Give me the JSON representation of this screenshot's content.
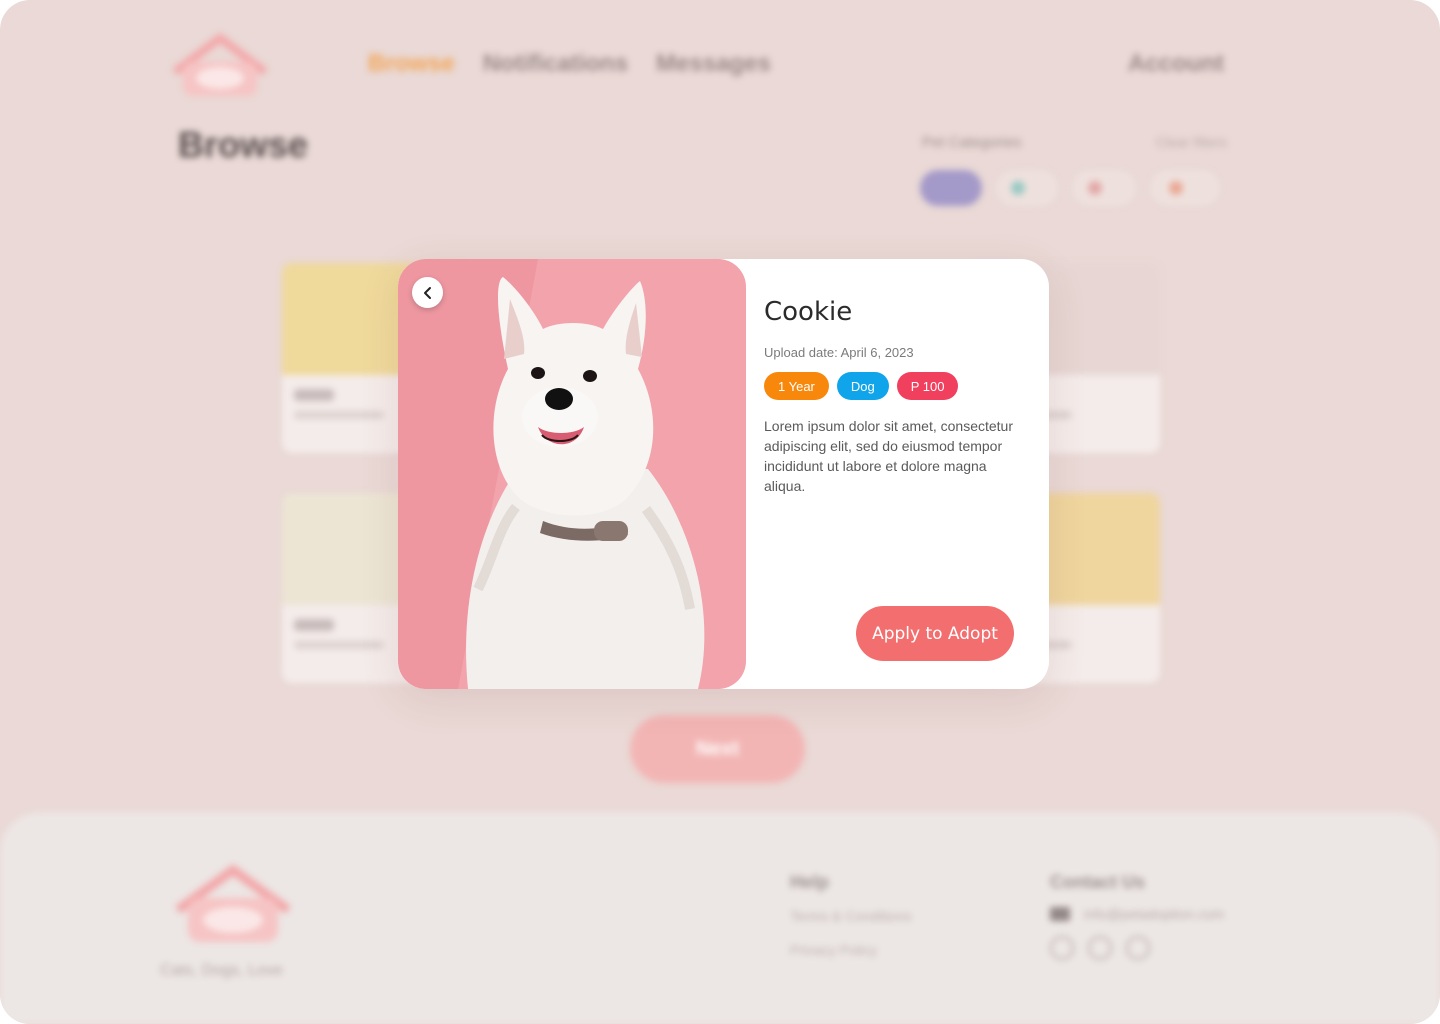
{
  "nav": {
    "items": [
      {
        "label": "Browse",
        "active": true
      },
      {
        "label": "Notifications",
        "active": false
      },
      {
        "label": "Messages",
        "active": false
      }
    ],
    "account": "Account"
  },
  "page": {
    "title": "Browse",
    "category_label": "Pet Categories",
    "clear_label": "Clear filters",
    "next_label": "Next"
  },
  "cards": [
    {
      "name": "Max",
      "sub": "Upload date"
    },
    {
      "name": "Milo",
      "sub": "Upload date"
    }
  ],
  "modal": {
    "pet_name": "Cookie",
    "upload_date": "Upload date: April 6, 2023",
    "tags": [
      {
        "label": "1 Year",
        "color": "#f8880b"
      },
      {
        "label": "Dog",
        "color": "#10a5ea"
      },
      {
        "label": "P 100",
        "color": "#f13f5e"
      }
    ],
    "description": "Lorem ipsum dolor sit amet, consectetur adipiscing elit, sed do eiusmod tempor incididunt ut labore et dolore magna aliqua.",
    "apply_label": "Apply to Adopt",
    "back_icon": "chevron-left-icon"
  },
  "footer": {
    "caption": "Cats, Dogs, Love",
    "help_heading": "Help",
    "help_links": [
      "Terms & Conditions",
      "Privacy Policy"
    ],
    "contact_heading": "Contact Us",
    "email": "info@petadoption.com"
  },
  "colors": {
    "accent": "#f36f6f",
    "nav_active": "#f3a04b",
    "photo_bg": "#f2a3ab"
  }
}
